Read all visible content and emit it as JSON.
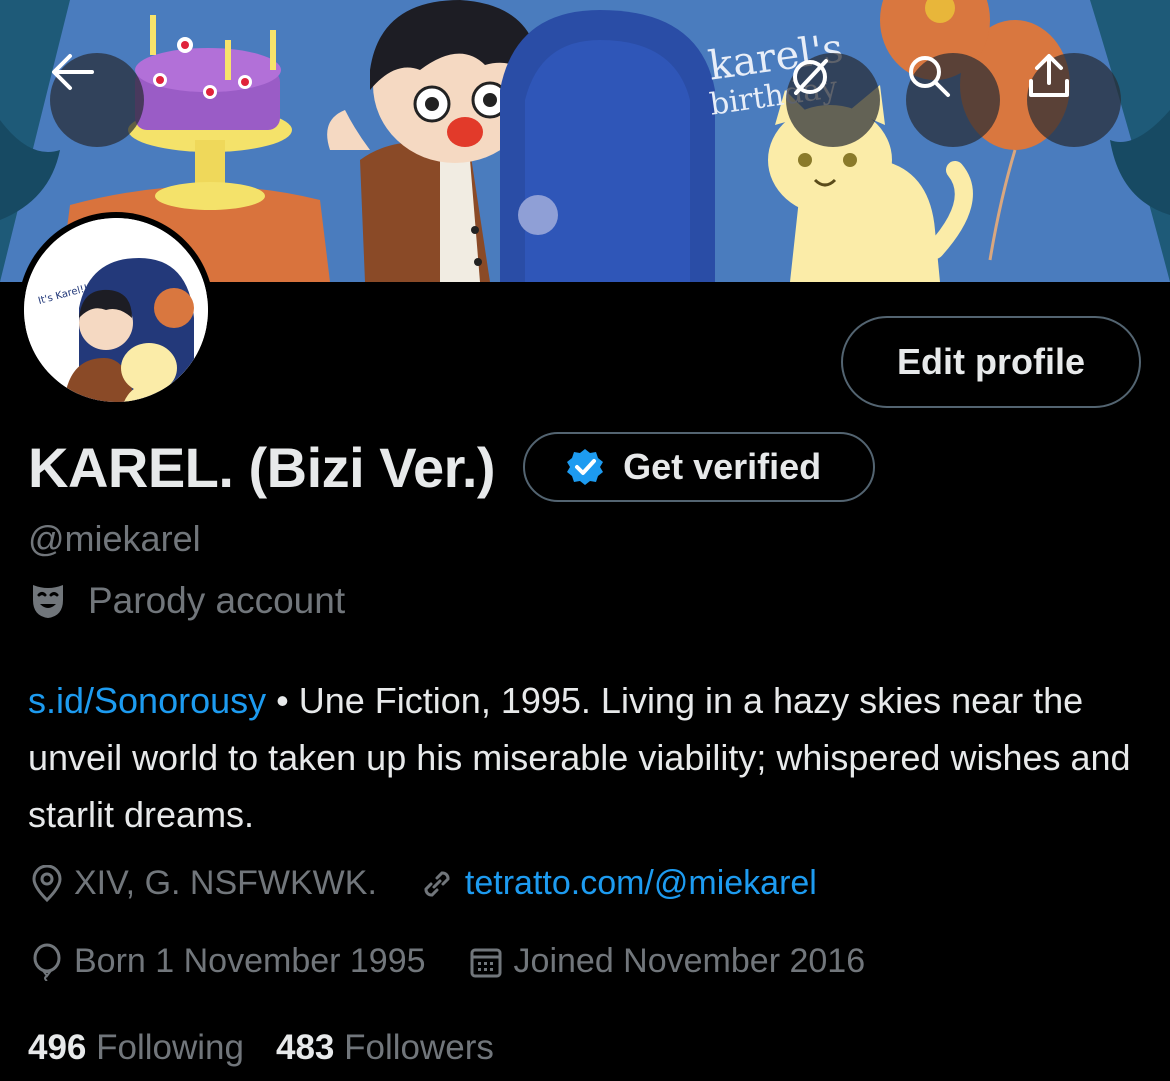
{
  "header": {
    "back_icon": "arrow-left-icon",
    "grok_icon": "grok-slash-icon",
    "search_icon": "search-icon",
    "share_icon": "share-upload-icon",
    "banner_text": "karel's birthday"
  },
  "profile": {
    "edit_label": "Edit profile",
    "display_name": "KAREL. (Bizi Ver.)",
    "verify_label": "Get verified",
    "handle": "@miekarel",
    "parody_label": "Parody account",
    "avatar_text": "It's Karel!!",
    "bio": {
      "link": "s.id/Sonorousy",
      "separator": " • ",
      "text": "Une Fiction, 1995. Living in a hazy skies near the unveil world to taken up his miserable viability; whispered wishes and starlit dreams."
    },
    "location": "XIV, G. NSFWKWK.",
    "website": "tetratto.com/@miekarel",
    "birth": "Born 1 November 1995",
    "joined": "Joined November 2016",
    "following_count": "496",
    "following_label": "Following",
    "followers_count": "483",
    "followers_label": "Followers"
  },
  "colors": {
    "accent": "#1d9bf0",
    "muted": "#71767b",
    "text": "#e7e9ea",
    "background": "#000000"
  }
}
